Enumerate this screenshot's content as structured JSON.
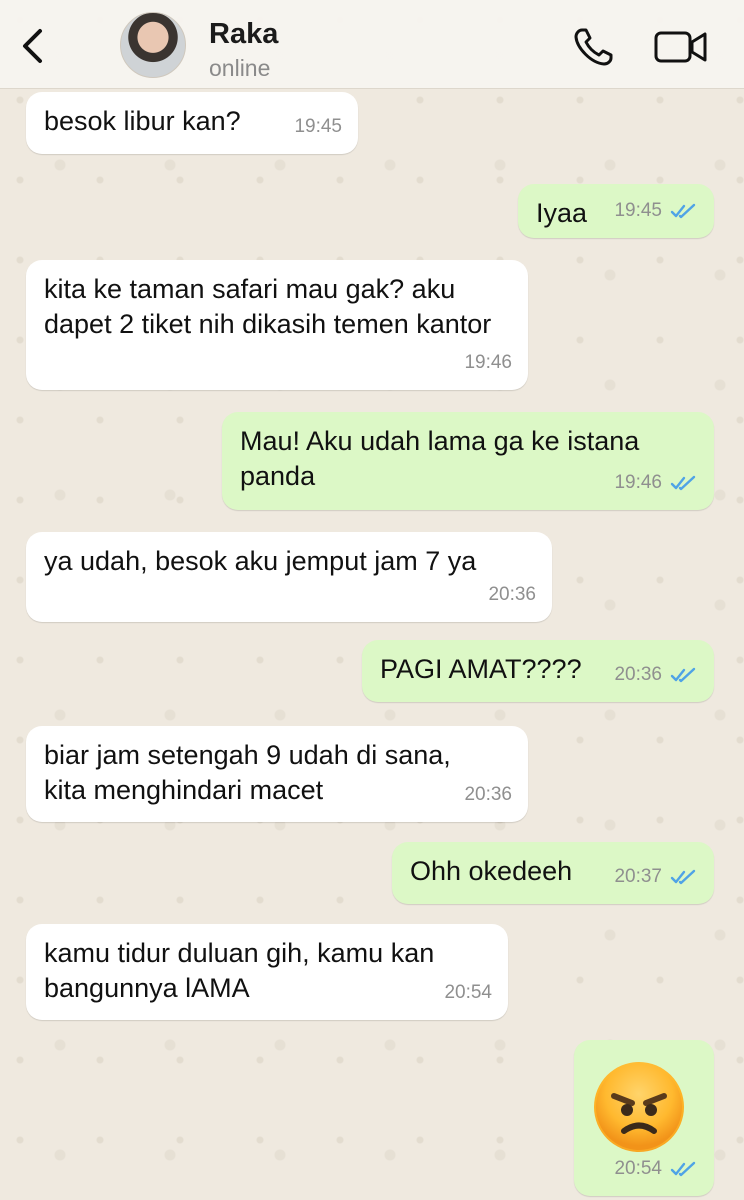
{
  "header": {
    "contact_name": "Raka",
    "status": "online"
  },
  "messages": [
    {
      "direction": "in",
      "text": "besok libur kan?",
      "time": "19:45"
    },
    {
      "direction": "out",
      "text": "Iyaa",
      "time": "19:45",
      "read": true
    },
    {
      "direction": "in",
      "text": "kita ke taman safari mau gak? aku dapet 2 tiket nih dikasih temen kantor",
      "time": "19:46"
    },
    {
      "direction": "out",
      "text": "Mau! Aku udah lama ga ke istana panda",
      "time": "19:46",
      "read": true
    },
    {
      "direction": "in",
      "text": "ya udah, besok aku jemput jam 7 ya",
      "time": "20:36"
    },
    {
      "direction": "out",
      "text": "PAGI AMAT????",
      "time": "20:36",
      "read": true
    },
    {
      "direction": "in",
      "text": "biar jam setengah 9 udah di sana, kita menghindari macet",
      "time": "20:36"
    },
    {
      "direction": "out",
      "text": "Ohh okedeeh",
      "time": "20:37",
      "read": true
    },
    {
      "direction": "in",
      "text": "kamu tidur duluan gih, kamu kan bangunnya lAMA",
      "time": "20:54"
    },
    {
      "direction": "out",
      "emoji": "angry-face",
      "time": "20:54",
      "read": true
    }
  ],
  "colors": {
    "incoming_bubble": "#ffffff",
    "outgoing_bubble": "#dcf8c6",
    "read_ticks": "#4fa3e6",
    "wallpaper": "#efe9df"
  }
}
